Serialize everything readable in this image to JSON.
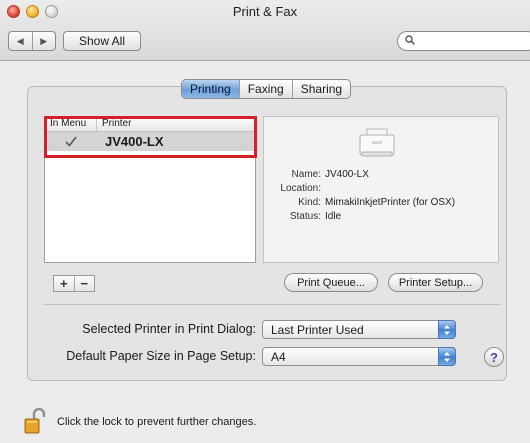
{
  "window": {
    "title": "Print & Fax"
  },
  "toolbar": {
    "show_all_label": "Show All",
    "search_placeholder": ""
  },
  "tabs": [
    {
      "label": "Printing",
      "active": true
    },
    {
      "label": "Faxing",
      "active": false
    },
    {
      "label": "Sharing",
      "active": false
    }
  ],
  "printer_list": {
    "col_in_menu": "In Menu",
    "col_printer": "Printer",
    "rows": [
      {
        "in_menu": true,
        "name": "JV400-LX"
      }
    ]
  },
  "add_button_label": "+",
  "remove_button_label": "−",
  "printer_info": {
    "name_label": "Name:",
    "name_value": "JV400-LX",
    "location_label": "Location:",
    "location_value": "",
    "kind_label": "Kind:",
    "kind_value": "MimakiInkjetPrinter (for OSX)",
    "status_label": "Status:",
    "status_value": "Idle"
  },
  "buttons": {
    "print_queue": "Print Queue...",
    "printer_setup": "Printer Setup..."
  },
  "settings": {
    "selected_printer_label": "Selected Printer in Print Dialog:",
    "selected_printer_value": "Last Printer Used",
    "paper_size_label": "Default Paper Size in Page Setup:",
    "paper_size_value": "A4"
  },
  "help_label": "?",
  "lock_text": "Click the lock to prevent further changes.",
  "colors": {
    "tab_active": "#6da1dc",
    "highlight": "#d4202a",
    "popup_arrows": "#3f7fd0"
  }
}
